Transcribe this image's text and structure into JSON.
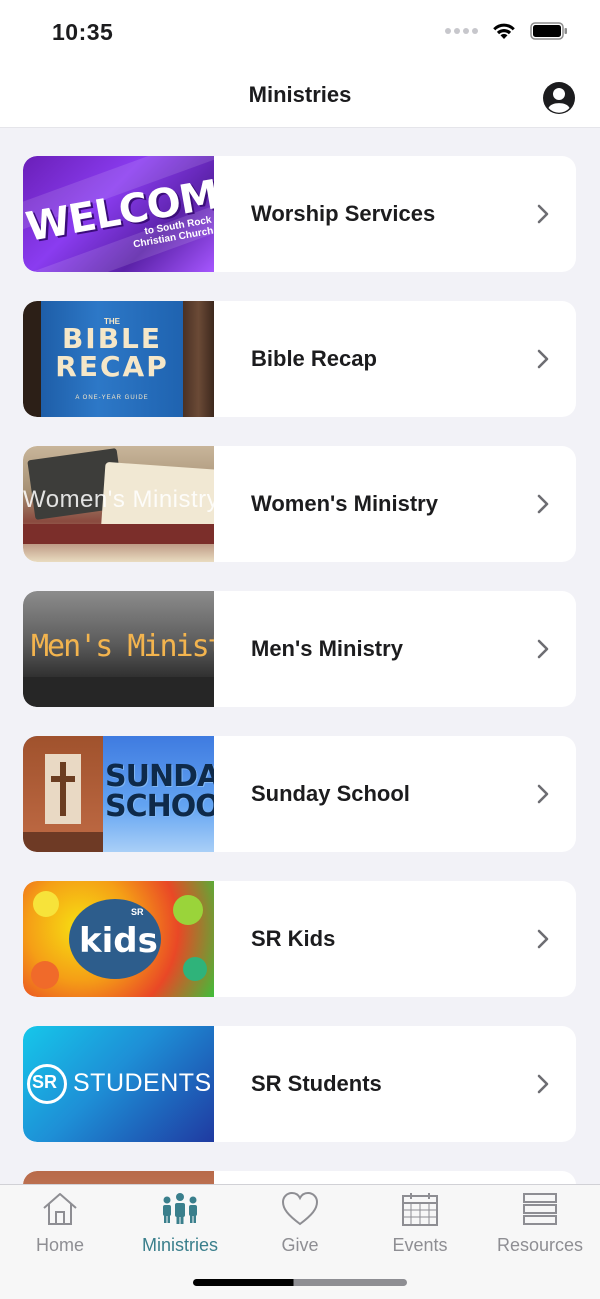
{
  "status_bar": {
    "time": "10:35"
  },
  "header": {
    "title": "Ministries",
    "profile_icon": "person-circle-icon"
  },
  "ministries": [
    {
      "label": "Worship Services",
      "thumb_caption": "WELCOME",
      "thumb_subcaption": "to South Rock Christian Church"
    },
    {
      "label": "Bible Recap",
      "thumb_the": "THE",
      "thumb_caption": "BIBLE RECAP",
      "thumb_subcaption": "A ONE-YEAR GUIDE"
    },
    {
      "label": "Women's Ministry",
      "thumb_caption": "Women's Ministry"
    },
    {
      "label": "Men's Ministry",
      "thumb_caption": "Men's Ministry"
    },
    {
      "label": "Sunday School",
      "thumb_caption": "SUNDAY SCHOOL"
    },
    {
      "label": "SR Kids",
      "thumb_caption": "kids",
      "thumb_badge": "SR"
    },
    {
      "label": "SR Students",
      "thumb_caption": "STUDENTS",
      "thumb_badge": "SR"
    }
  ],
  "tabs": [
    {
      "label": "Home",
      "icon": "house-icon",
      "active": false
    },
    {
      "label": "Ministries",
      "icon": "people-icon",
      "active": true
    },
    {
      "label": "Give",
      "icon": "heart-icon",
      "active": false
    },
    {
      "label": "Events",
      "icon": "calendar-icon",
      "active": false
    },
    {
      "label": "Resources",
      "icon": "stack-icon",
      "active": false
    }
  ],
  "colors": {
    "accent": "#3a7f8c",
    "inactive": "#8e8e93",
    "background": "#f2f2f7"
  }
}
